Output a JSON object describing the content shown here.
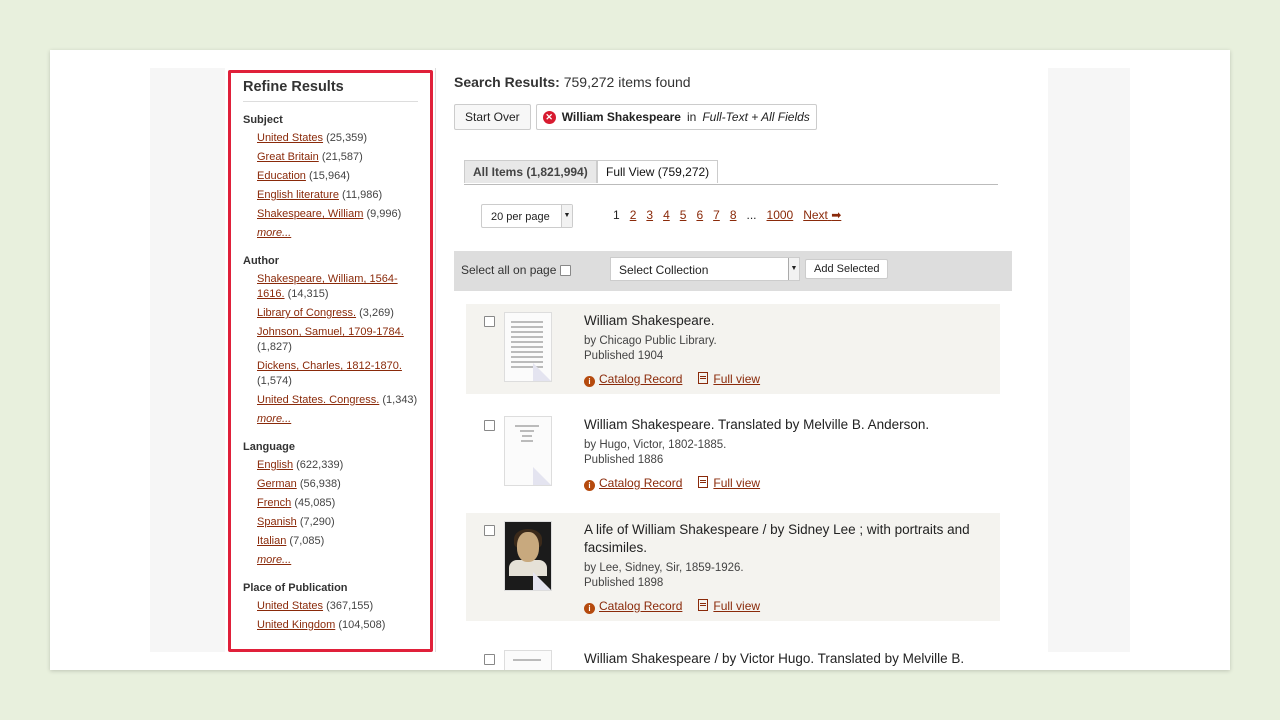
{
  "sidebar": {
    "title": "Refine Results",
    "facets": [
      {
        "heading": "Subject",
        "items": [
          {
            "label": "United States",
            "count": "(25,359)"
          },
          {
            "label": "Great Britain",
            "count": "(21,587)"
          },
          {
            "label": "Education",
            "count": "(15,964)"
          },
          {
            "label": "English literature",
            "count": "(11,986)"
          },
          {
            "label": "Shakespeare, William",
            "count": "(9,996)"
          }
        ],
        "more": "more..."
      },
      {
        "heading": "Author",
        "items": [
          {
            "label": "Shakespeare, William, 1564-1616.",
            "count": "(14,315)"
          },
          {
            "label": "Library of Congress.",
            "count": "(3,269)"
          },
          {
            "label": "Johnson, Samuel, 1709-1784.",
            "count": "(1,827)"
          },
          {
            "label": "Dickens, Charles, 1812-1870.",
            "count": "(1,574)"
          },
          {
            "label": "United States. Congress.",
            "count": "(1,343)"
          }
        ],
        "more": "more..."
      },
      {
        "heading": "Language",
        "items": [
          {
            "label": "English",
            "count": "(622,339)"
          },
          {
            "label": "German",
            "count": "(56,938)"
          },
          {
            "label": "French",
            "count": "(45,085)"
          },
          {
            "label": "Spanish",
            "count": "(7,290)"
          },
          {
            "label": "Italian",
            "count": "(7,085)"
          }
        ],
        "more": "more..."
      },
      {
        "heading": "Place of Publication",
        "items": [
          {
            "label": "United States",
            "count": "(367,155)"
          },
          {
            "label": "United Kingdom",
            "count": "(104,508)"
          }
        ]
      }
    ]
  },
  "main": {
    "results_label": "Search Results:",
    "results_count": "759,272 items found",
    "start_over": "Start Over",
    "filter": {
      "term": "William Shakespeare",
      "in": "in",
      "scope": "Full-Text + All Fields"
    },
    "tabs": [
      {
        "label": "All Items (1,821,994)"
      },
      {
        "label": "Full View (759,272)"
      }
    ],
    "per_page": "20 per page",
    "pages": [
      "1",
      "2",
      "3",
      "4",
      "5",
      "6",
      "7",
      "8",
      "...",
      "1000"
    ],
    "next": "Next",
    "select_all": "Select all on page",
    "collection": "Select Collection",
    "add_selected": "Add Selected",
    "catalog_label": "Catalog Record",
    "full_view_label": "Full view",
    "records": [
      {
        "title": "William Shakespeare.",
        "by": "by Chicago Public Library.",
        "published": "Published 1904"
      },
      {
        "title": "William Shakespeare. Translated by Melville B. Anderson.",
        "by": "by Hugo, Victor, 1802-1885.",
        "published": "Published 1886"
      },
      {
        "title": "A life of William Shakespeare / by Sidney Lee ; with portraits and facsimiles.",
        "by": "by Lee, Sidney, Sir, 1859-1926.",
        "published": "Published 1898"
      },
      {
        "title": "William Shakespeare / by Victor Hugo. Translated by Melville B."
      }
    ]
  },
  "colors": {
    "highlight_border": "#e0203a",
    "link": "#8a2a0a",
    "background": "#e8f0dd"
  }
}
